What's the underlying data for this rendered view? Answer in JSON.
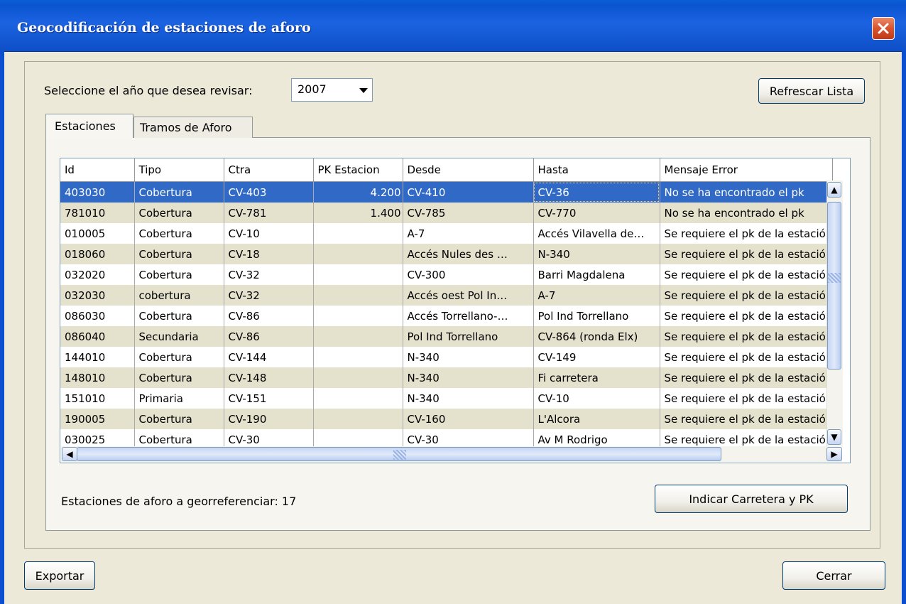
{
  "window": {
    "title": "Geocodificación de estaciones de aforo"
  },
  "year_selector": {
    "label": "Seleccione el año que desea revisar:",
    "value": "2007"
  },
  "buttons": {
    "refresh": "Refrescar Lista",
    "set_road_pk": "Indicar Carretera y PK",
    "export": "Exportar",
    "close": "Cerrar"
  },
  "tabs": [
    {
      "label": "Estaciones",
      "selected": true
    },
    {
      "label": "Tramos de Aforo",
      "selected": false
    }
  ],
  "table": {
    "columns": [
      "Id",
      "Tipo",
      "Ctra",
      "PK Estacion",
      "Desde",
      "Hasta",
      "Mensaje Error"
    ],
    "rows": [
      [
        "403030",
        "Cobertura",
        "CV-403",
        "4.200",
        "CV-410",
        "CV-36",
        "No se ha encontrado el pk"
      ],
      [
        "781010",
        "Cobertura",
        "CV-781",
        "1.400",
        "CV-785",
        "CV-770",
        "No se ha encontrado el pk"
      ],
      [
        "010005",
        "Cobertura",
        "CV-10",
        "",
        "A-7",
        "Accés Vilavella de…",
        "Se requiere el pk de la estación"
      ],
      [
        "018060",
        "Cobertura",
        "CV-18",
        "",
        "Accés Nules des …",
        "N-340",
        "Se requiere el pk de la estación"
      ],
      [
        "032020",
        "Cobertura",
        "CV-32",
        "",
        "CV-300",
        "Barri Magdalena",
        "Se requiere el pk de la estación"
      ],
      [
        "032030",
        "cobertura",
        "CV-32",
        "",
        "Accés oest Pol In…",
        "A-7",
        "Se requiere el pk de la estación"
      ],
      [
        "086030",
        "Cobertura",
        "CV-86",
        "",
        "Accés Torrellano-…",
        "Pol Ind Torrellano",
        "Se requiere el pk de la estación"
      ],
      [
        "086040",
        "Secundaria",
        "CV-86",
        "",
        "Pol Ind Torrellano",
        "CV-864 (ronda Elx)",
        "Se requiere el pk de la estación"
      ],
      [
        "144010",
        "Cobertura",
        "CV-144",
        "",
        "N-340",
        "CV-149",
        "Se requiere el pk de la estación"
      ],
      [
        "148010",
        "Cobertura",
        "CV-148",
        "",
        "N-340",
        "Fi carretera",
        "Se requiere el pk de la estación"
      ],
      [
        "151010",
        "Primaria",
        "CV-151",
        "",
        "N-340",
        "CV-10",
        "Se requiere el pk de la estación"
      ],
      [
        "190005",
        "Cobertura",
        "CV-190",
        "",
        "CV-160",
        "L'Alcora",
        "Se requiere el pk de la estación"
      ],
      [
        "030025",
        "Cobertura",
        "CV-30",
        "",
        "CV-30",
        "Av M Rodrigo",
        "Se requiere el pk de la estación"
      ]
    ],
    "selected_row": 0
  },
  "status_text": "Estaciones de aforo a georreferenciar: 17"
}
